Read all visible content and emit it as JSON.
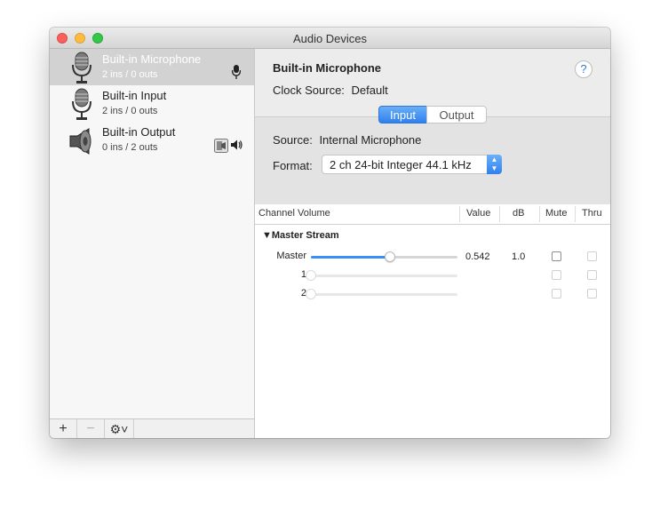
{
  "window": {
    "title": "Audio Devices"
  },
  "devices": [
    {
      "name": "Built-in Microphone",
      "channels": "2 ins / 0 outs",
      "icon": "microphone-icon",
      "selected": true,
      "badge": "mic-badge-icon"
    },
    {
      "name": "Built-in Input",
      "channels": "2 ins / 0 outs",
      "icon": "microphone-icon",
      "selected": false
    },
    {
      "name": "Built-in Output",
      "channels": "0 ins / 2 outs",
      "icon": "speaker-icon",
      "selected": false,
      "badge": "finder-speaker-badge-icon"
    }
  ],
  "sidebar_toolbar": {
    "add": "+",
    "remove": "−",
    "gear": "⚙˅"
  },
  "detail": {
    "device_name": "Built-in Microphone",
    "clock_source_label": "Clock Source:",
    "clock_source_value": "Default",
    "help": "?",
    "tabs": [
      "Input",
      "Output"
    ],
    "active_tab": "Input",
    "source_label": "Source:",
    "source_value": "Internal Microphone",
    "format_label": "Format:",
    "format_value": "2 ch 24-bit Integer 44.1 kHz"
  },
  "table": {
    "headers": {
      "channel": "Channel Volume",
      "value": "Value",
      "db": "dB",
      "mute": "Mute",
      "thru": "Thru"
    },
    "group": "▼Master Stream",
    "rows": [
      {
        "label": "Master",
        "volume": 0.542,
        "value": "0.542",
        "db": "1.0",
        "enabled": true
      },
      {
        "label": "1",
        "volume": 0,
        "value": "",
        "db": "",
        "enabled": false
      },
      {
        "label": "2",
        "volume": 0,
        "value": "",
        "db": "",
        "enabled": false
      }
    ]
  },
  "colors": {
    "accent": "#2f81ef",
    "selection": "#d2d2d2"
  }
}
